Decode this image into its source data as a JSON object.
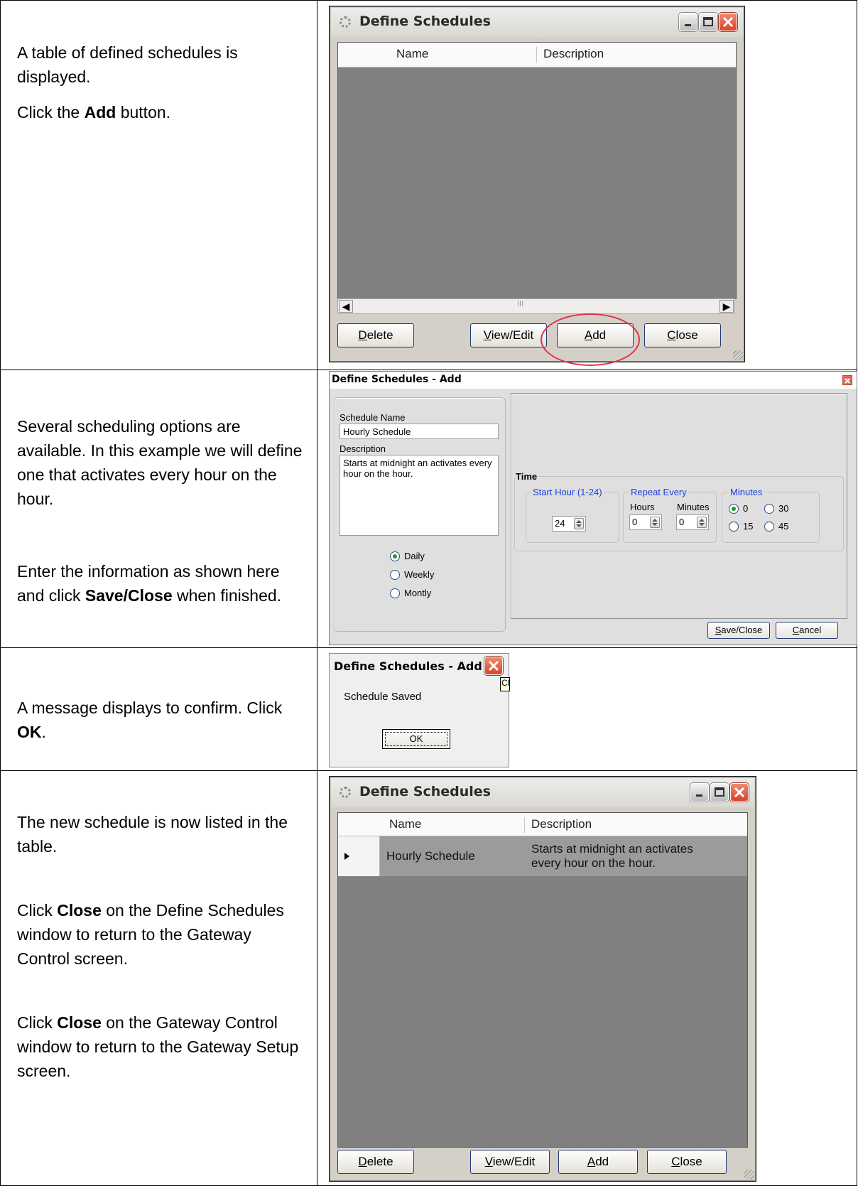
{
  "rows": [
    {
      "paragraphs": [
        [
          {
            "t": "A table of defined schedules is displayed.",
            "b": false
          }
        ],
        [
          {
            "t": " Click the ",
            "b": false
          },
          {
            "t": "Add",
            "b": true
          },
          {
            "t": " button.",
            "b": false
          }
        ]
      ]
    },
    {
      "paragraphs": [
        [
          {
            "t": "Several scheduling options are available. In this example we will define one that activates every hour on the hour.",
            "b": false
          }
        ],
        [
          {
            "t": "Enter the information as shown here and click ",
            "b": false
          },
          {
            "t": "Save/Close",
            "b": true
          },
          {
            "t": " when finished.",
            "b": false
          }
        ]
      ]
    },
    {
      "paragraphs": [
        [
          {
            "t": "A message displays to confirm. Click ",
            "b": false
          },
          {
            "t": "OK",
            "b": true
          },
          {
            "t": ".",
            "b": false
          }
        ]
      ]
    },
    {
      "paragraphs": [
        [
          {
            "t": "The new schedule is now listed in the table.",
            "b": false
          }
        ],
        [
          {
            "t": "Click ",
            "b": false
          },
          {
            "t": "Close",
            "b": true
          },
          {
            "t": " on the Define Schedules window to return to the Gateway Control screen.",
            "b": false
          }
        ],
        [
          {
            "t": "Click ",
            "b": false
          },
          {
            "t": "Close",
            "b": true
          },
          {
            "t": " on the Gateway Control window to return to the Gateway Setup screen.",
            "b": false
          }
        ]
      ]
    }
  ],
  "win1": {
    "title": "Define Schedules",
    "col_name": "Name",
    "col_desc": "Description",
    "scroll_mark": "III",
    "btn_delete": {
      "key": "D",
      "rest": "elete"
    },
    "btn_view": {
      "key": "V",
      "rest": "iew/Edit"
    },
    "btn_add": {
      "key": "A",
      "rest": "dd"
    },
    "btn_close": {
      "key": "C",
      "rest": "lose"
    }
  },
  "dlg": {
    "title": "Define Schedules - Add",
    "schedule_name_label": "Schedule Name",
    "schedule_name_value": "Hourly Schedule",
    "description_label": "Description",
    "description_value": "Starts at midnight an activates every hour on the hour.",
    "freq_options": [
      {
        "label": "Daily",
        "selected": true
      },
      {
        "label": "Weekly",
        "selected": false
      },
      {
        "label": "Montly",
        "selected": false
      }
    ],
    "time_label": "Time",
    "start_hour_label": "Start Hour (1-24)",
    "start_hour_value": "24",
    "repeat_label": "Repeat Every",
    "hours_label": "Hours",
    "minutes_label": "Minutes",
    "repeat_hours_value": "0",
    "repeat_minutes_value": "0",
    "minutes_group_label": "Minutes",
    "minute_options": [
      {
        "label": "0",
        "selected": true
      },
      {
        "label": "30",
        "selected": false
      },
      {
        "label": "15",
        "selected": false
      },
      {
        "label": "45",
        "selected": false
      }
    ],
    "btn_save": {
      "key": "S",
      "rest": "ave/Close"
    },
    "btn_cancel": {
      "key": "C",
      "rest": "ancel"
    }
  },
  "msgbox": {
    "title": "Define Schedules - Add",
    "message": "Schedule Saved",
    "ok_label": "OK",
    "tooltip_fragment": "Cl"
  },
  "win2": {
    "title": "Define Schedules",
    "col_name": "Name",
    "col_desc": "Description",
    "row_name": "Hourly Schedule",
    "row_desc_line1": "Starts at midnight an activates",
    "row_desc_line2": "every hour on the hour.",
    "btn_delete": {
      "key": "D",
      "rest": "elete"
    },
    "btn_view": {
      "key": "V",
      "rest": "iew/Edit"
    },
    "btn_add": {
      "key": "A",
      "rest": "dd"
    },
    "btn_close": {
      "key": "C",
      "rest": "lose"
    }
  }
}
